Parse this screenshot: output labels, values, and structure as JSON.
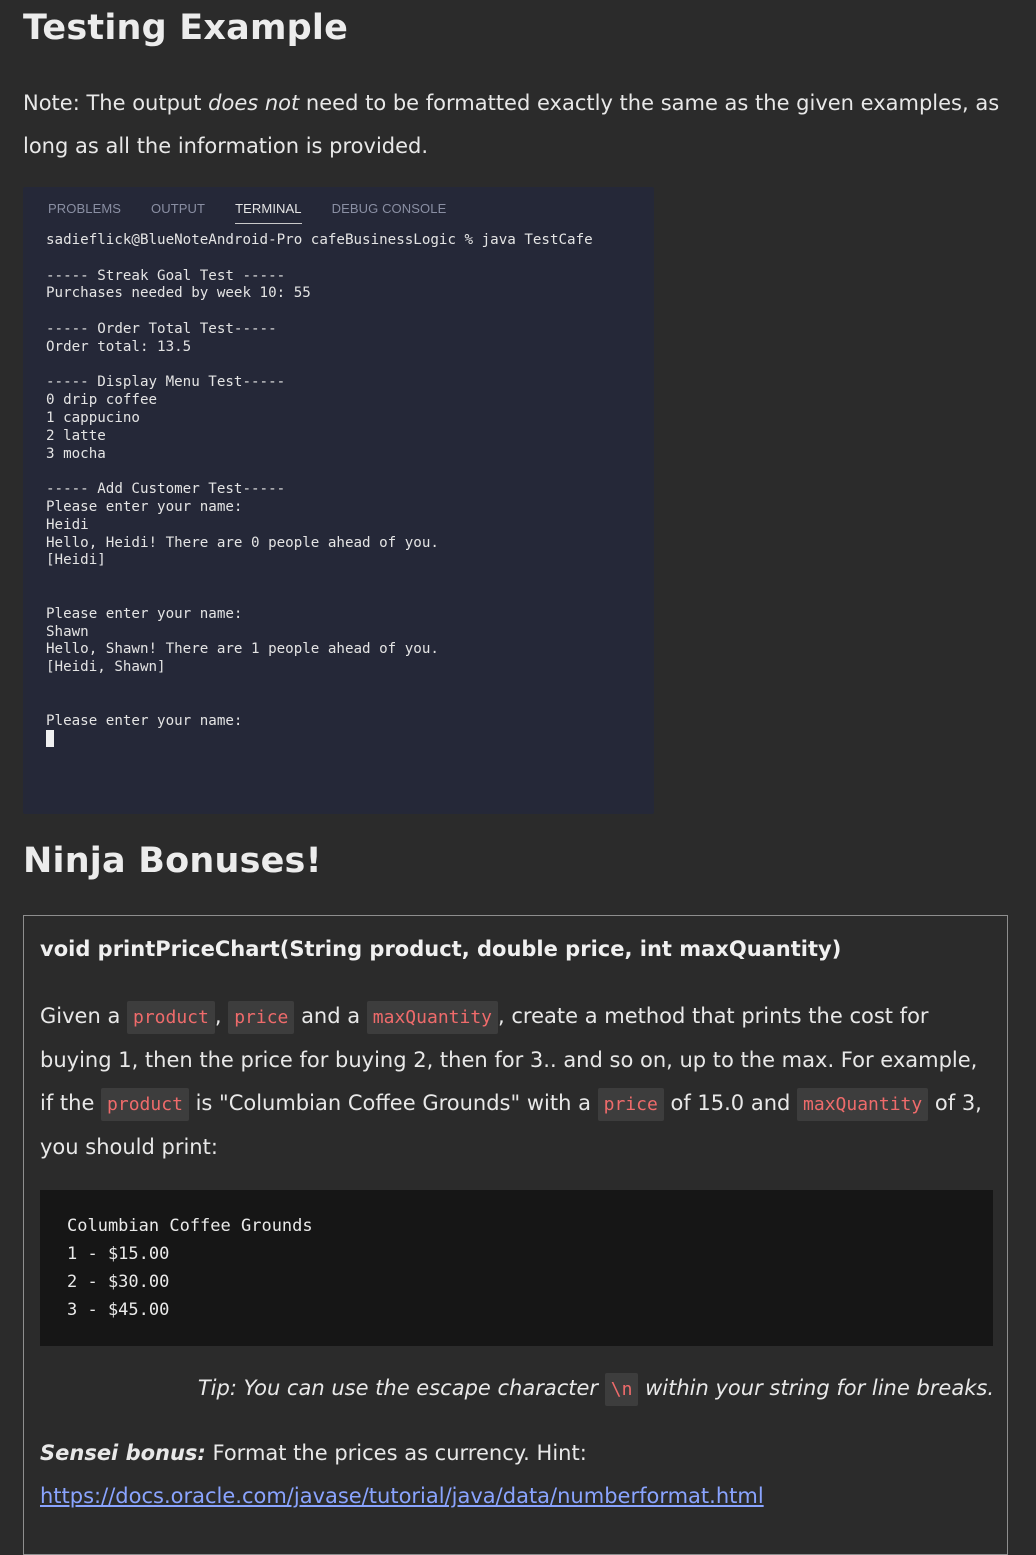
{
  "sections": {
    "testing_title": "Testing Example",
    "ninja_title": "Ninja Bonuses!"
  },
  "note": {
    "prefix": "Note: The output ",
    "emphasis": "does not",
    "suffix": " need to be formatted exactly the same as the given examples, as long as all the information is provided."
  },
  "terminal": {
    "tabs": [
      {
        "label": "PROBLEMS",
        "active": false
      },
      {
        "label": "OUTPUT",
        "active": false
      },
      {
        "label": "TERMINAL",
        "active": true
      },
      {
        "label": "DEBUG CONSOLE",
        "active": false
      }
    ],
    "lines": [
      "sadieflick@BlueNoteAndroid-Pro cafeBusinessLogic % java TestCafe",
      "",
      "----- Streak Goal Test -----",
      "Purchases needed by week 10: 55",
      "",
      "----- Order Total Test-----",
      "Order total: 13.5",
      "",
      "----- Display Menu Test-----",
      "0 drip coffee",
      "1 cappucino",
      "2 latte",
      "3 mocha",
      "",
      "----- Add Customer Test-----",
      "Please enter your name:",
      "Heidi",
      "Hello, Heidi! There are 0 people ahead of you.",
      "[Heidi]",
      "",
      "",
      "Please enter your name:",
      "Shawn",
      "Hello, Shawn! There are 1 people ahead of you.",
      "[Heidi, Shawn]",
      "",
      "",
      "Please enter your name:"
    ]
  },
  "bonus": {
    "signature": "void printPriceChart(String product, double price, int maxQuantity)",
    "desc": {
      "t1": "Given a ",
      "c1": "product",
      "t2": ", ",
      "c2": "price",
      "t3": " and a ",
      "c3": "maxQuantity",
      "t4": ", create a method that prints the cost for buying 1, then the price for buying 2, then for 3.. and so on, up to the max. For example, if the ",
      "c4": "product",
      "t5": " is \"Columbian Coffee Grounds\" with a ",
      "c5": "price",
      "t6": " of 15.0 and ",
      "c6": "maxQuantity",
      "t7": " of 3, you should print:"
    },
    "code_lines": [
      "Columbian Coffee Grounds",
      "1 - $15.00",
      "2 - $30.00",
      "3 - $45.00"
    ],
    "tip": {
      "before": "Tip: You can use the escape character ",
      "code": "\\n",
      "after": " within your string for line breaks."
    },
    "sensei": {
      "label": "Sensei bonus:",
      "text": " Format the prices as currency. Hint:",
      "link": "https://docs.oracle.com/javase/tutorial/java/data/numberformat.html"
    }
  }
}
